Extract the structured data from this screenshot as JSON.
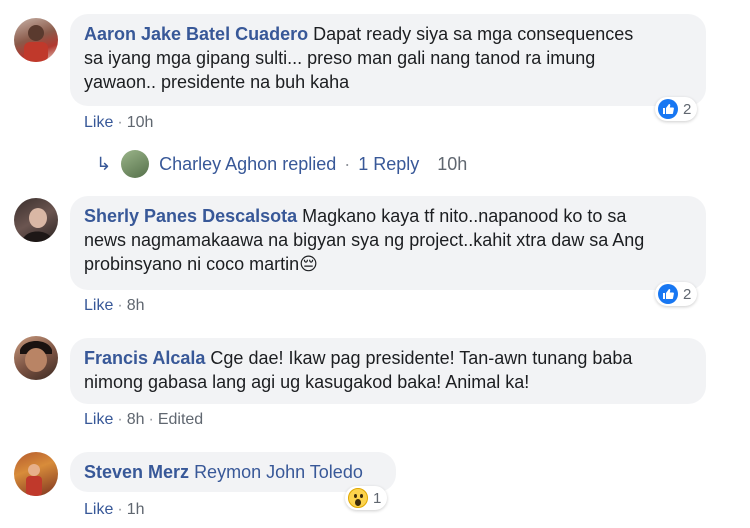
{
  "comments": [
    {
      "author": "Aaron Jake Batel Cuadero",
      "text": "Dapat ready siya sa mga consequences sa iyang mga gipang sulti... preso man gali nang tanod ra imung yawaon.. presidente na buh kaha",
      "line1": "Dapat ready siya sa mga consequences",
      "line2": "sa iyang mga gipang sulti... preso man gali nang tanod ra imung",
      "line3": "yawaon.. presidente na buh kaha",
      "like": "Like",
      "time": "10h",
      "reaction_count": "2",
      "reaction_icon": "like-icon",
      "reply": {
        "name": "Charley Aghon",
        "verb": "replied",
        "count_label": "1 Reply",
        "time": "10h",
        "separator": "·"
      }
    },
    {
      "author": "Sherly Panes Descalsota",
      "line1": "Magkano kaya tf nito..napanood ko to sa",
      "line2": "news nagmamakaawa na bigyan sya ng project..kahit xtra daw sa Ang",
      "line3": "probinsyano ni coco martin",
      "emoji": "😔",
      "like": "Like",
      "time": "8h",
      "reaction_count": "2",
      "reaction_icon": "like-icon"
    },
    {
      "author": "Francis Alcala",
      "line1": "Cge dae! Ikaw pag presidente! Tan-awn tunang baba",
      "line2": "nimong gabasa lang agi ug kasugakod baka! Animal ka!",
      "like": "Like",
      "time": "8h",
      "edited": "Edited"
    },
    {
      "author": "Steven Merz",
      "mention": "Reymon John Toledo",
      "like": "Like",
      "time": "1h",
      "reaction_count": "1",
      "reaction_icon": "wow-icon"
    }
  ],
  "separator": "·",
  "colors": {
    "link": "#385898",
    "bubble": "#f2f3f5",
    "meta": "#606770",
    "like_blue": "#1877f2"
  }
}
